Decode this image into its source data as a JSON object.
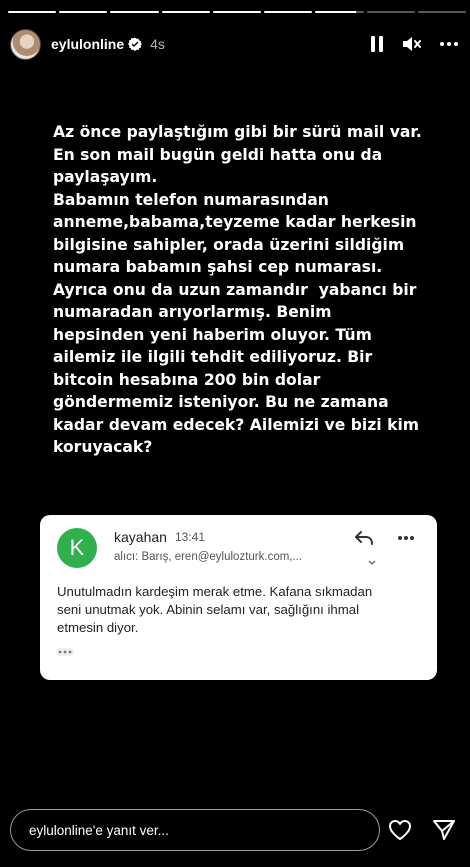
{
  "progress": [
    1,
    1,
    1,
    1,
    1,
    1,
    0.85,
    0,
    0
  ],
  "header": {
    "username": "eylulonline",
    "time": "4s",
    "verified": true
  },
  "story": {
    "lines": [
      "Az önce paylaştığım gibi bir sürü mail var.",
      "En son mail bugün geldi hatta onu da",
      "paylaşayım.",
      "Babamın telefon numarasından",
      "anneme,babama,teyzeme kadar herkesin",
      "bilgisine sahipler, orada üzerini sildiğim",
      "numara babamın şahsi cep numarası.",
      "Ayrıca onu da uzun zamandır  yabancı bir",
      "numaradan arıyorlarmış. Benim",
      "hepsinden yeni haberim oluyor. Tüm",
      "ailemiz ile ilgili tehdit ediliyoruz. Bir",
      "bitcoin hesabına 200 bin dolar",
      "göndermemiz isteniyor. Bu ne zamana",
      "kadar devam edecek? Ailemizi ve bizi kim",
      "koruyacak?"
    ]
  },
  "email": {
    "avatar_letter": "K",
    "avatar_color": "#2fb04d",
    "sender": "kayahan",
    "time": "13:41",
    "recipients": "alıcı: Barış, eren@eylulozturk.com,...",
    "body_lines": [
      "Unutulmadın kardeşim merak etme. Kafana sıkmadan",
      "seni unutmak yok. Abinin selamı var, sağlığını ihmal",
      "etmesin diyor."
    ]
  },
  "footer": {
    "reply_placeholder": "eylulonline'e yanıt ver..."
  },
  "icons": {
    "verified": "verified-badge-icon",
    "pause": "pause-icon",
    "mute": "mute-icon",
    "more": "more-icon",
    "reply": "reply-arrow-icon",
    "heart": "heart-icon",
    "send": "send-icon"
  }
}
